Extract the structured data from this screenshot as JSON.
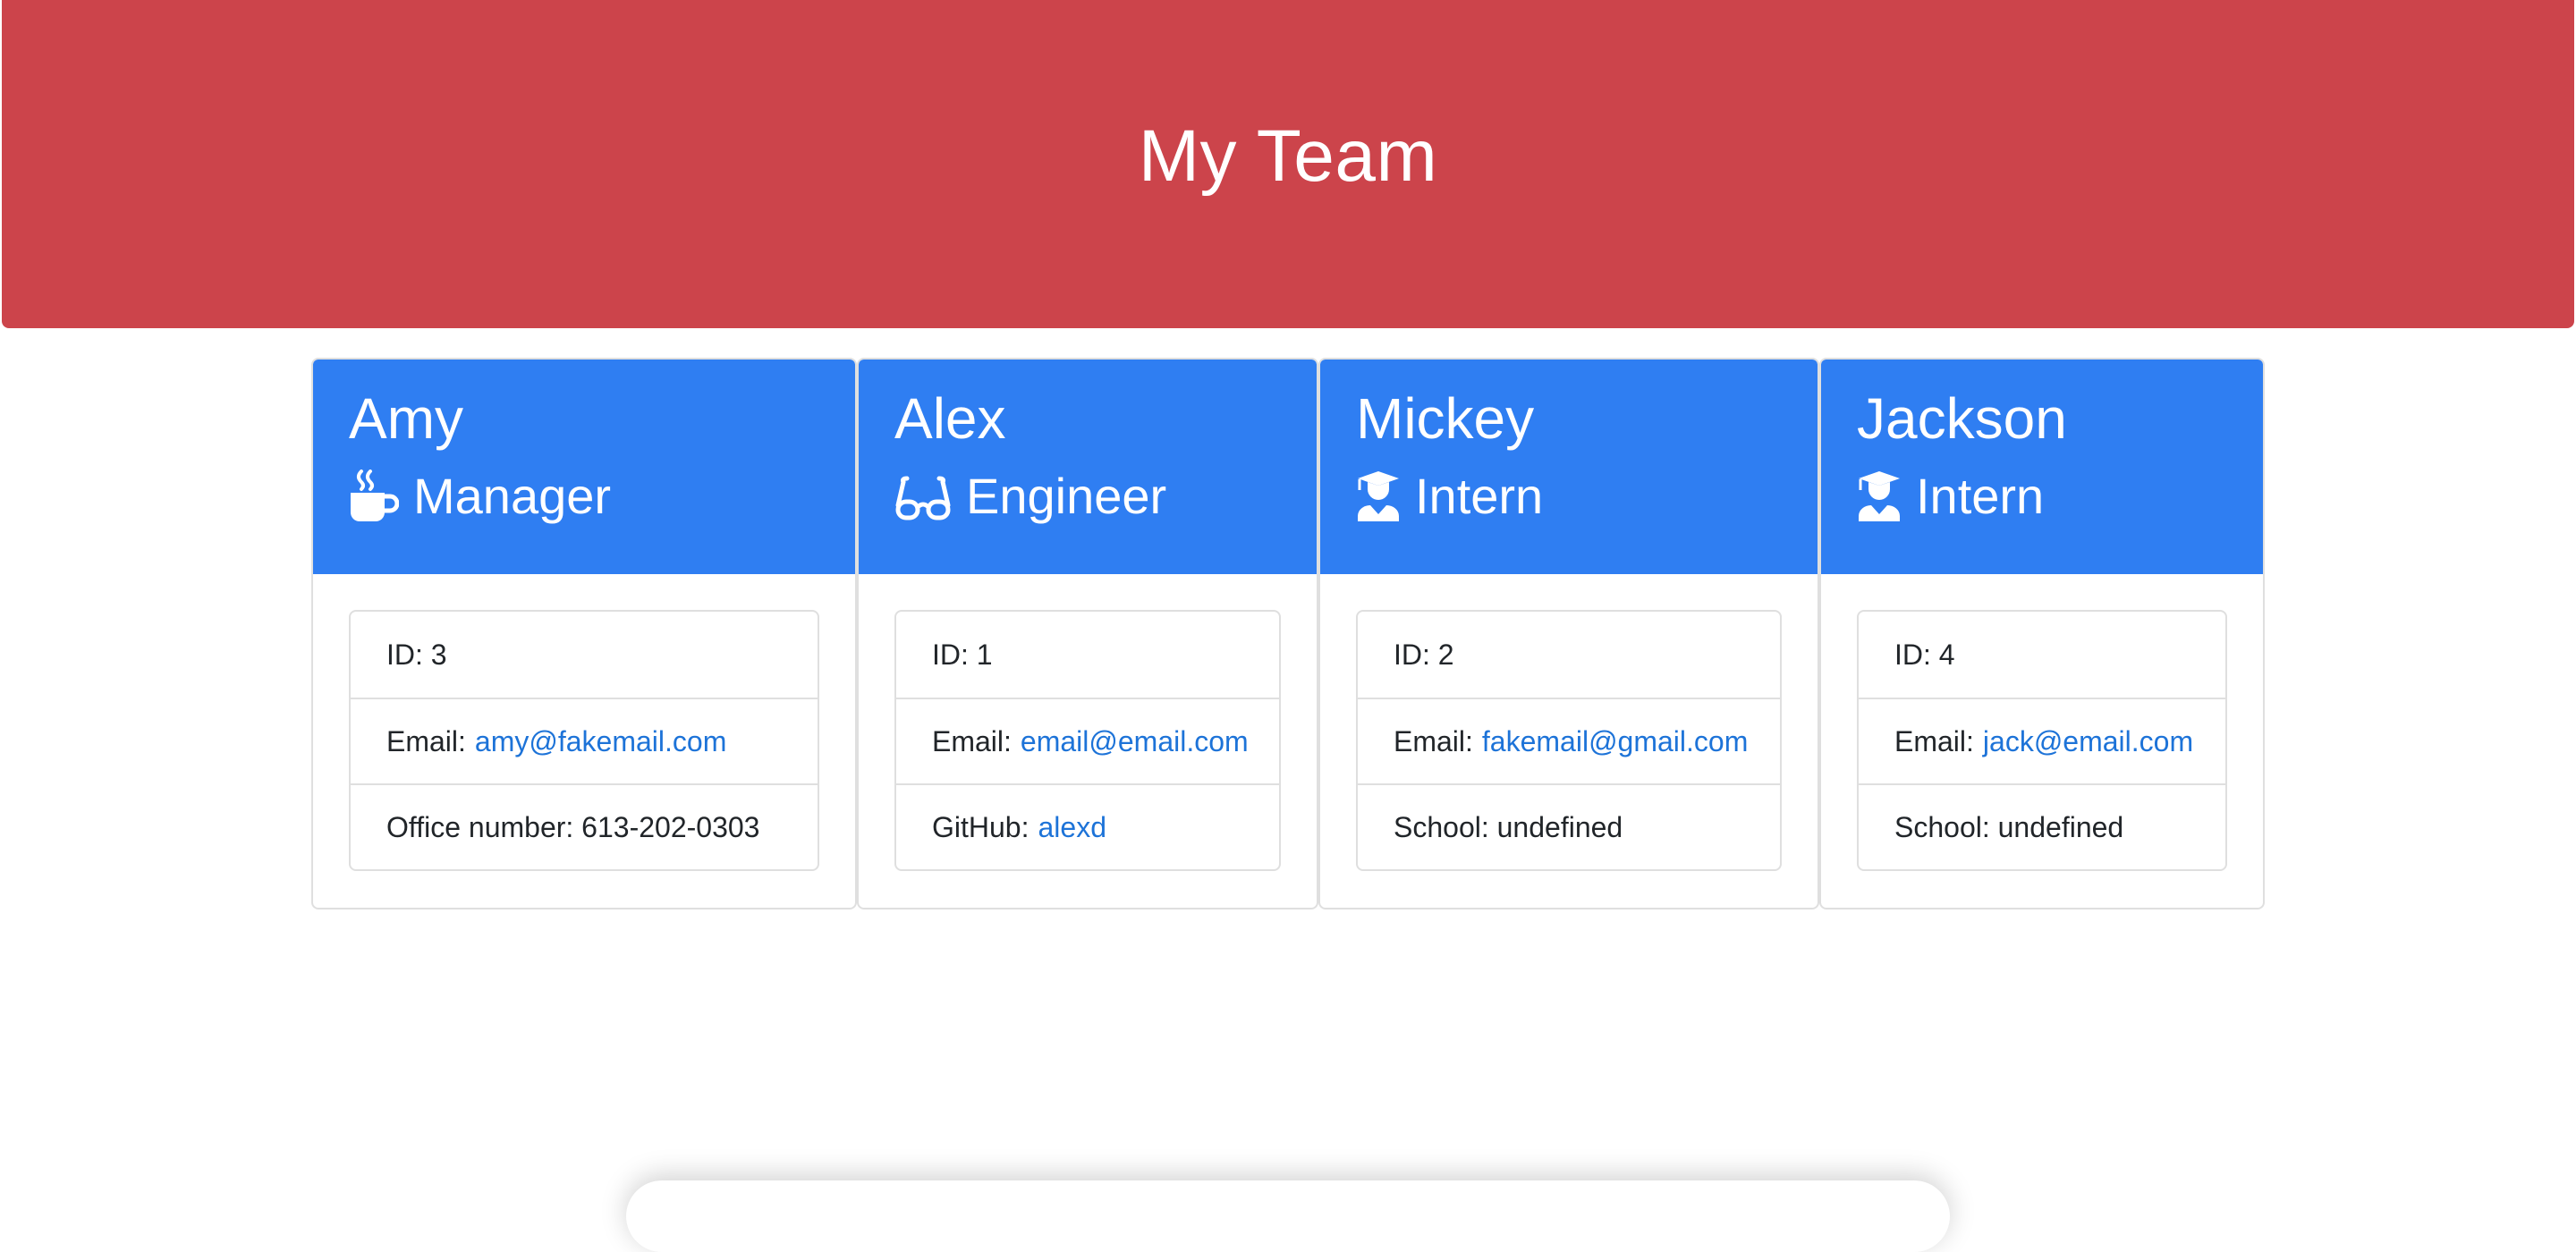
{
  "header": {
    "title": "My Team",
    "background": "#cc444b"
  },
  "theme": {
    "card_header_color": "#2f7ef2",
    "link_color": "#1d73d8"
  },
  "cards": [
    {
      "name": "Amy",
      "role": "Manager",
      "icon": "mug-icon",
      "id_text": "ID: 3",
      "email_label": "Email:",
      "email": "amy@fakemail.com",
      "extra_text": "Office number: 613-202-0303"
    },
    {
      "name": "Alex",
      "role": "Engineer",
      "icon": "glasses-icon",
      "id_text": "ID: 1",
      "email_label": "Email:",
      "email": "email@email.com",
      "extra_label": "GitHub:",
      "extra_link": "alexd"
    },
    {
      "name": "Mickey",
      "role": "Intern",
      "icon": "graduate-icon",
      "id_text": "ID: 2",
      "email_label": "Email:",
      "email": "fakemail@gmail.com",
      "extra_text": "School: undefined"
    },
    {
      "name": "Jackson",
      "role": "Intern",
      "icon": "graduate-icon",
      "id_text": "ID: 4",
      "email_label": "Email:",
      "email": "jack@email.com",
      "extra_text": "School: undefined"
    }
  ]
}
